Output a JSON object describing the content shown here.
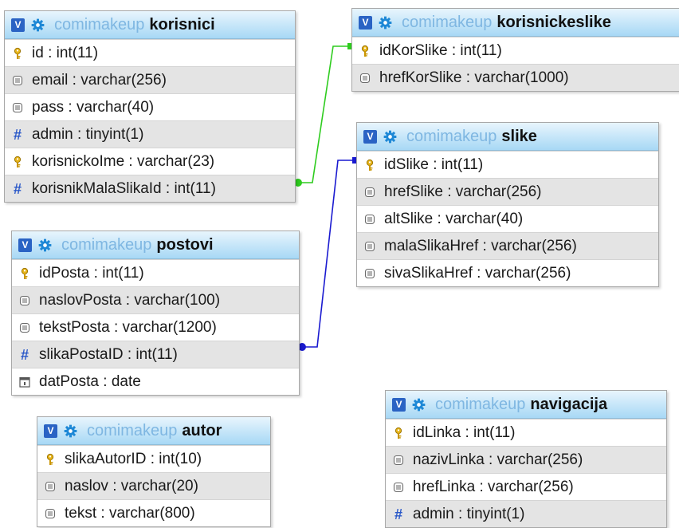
{
  "database": "comimakeup",
  "tables": {
    "korisnici": {
      "name": "korisnici",
      "columns": [
        {
          "text": "id : int(11)",
          "icon": "key-icon"
        },
        {
          "text": "email : varchar(256)",
          "icon": "text-column-icon"
        },
        {
          "text": "pass : varchar(40)",
          "icon": "text-column-icon"
        },
        {
          "text": "admin : tinyint(1)",
          "icon": "numeric-column-icon"
        },
        {
          "text": "korisnickoIme : varchar(23)",
          "icon": "key-icon"
        },
        {
          "text": "korisnikMalaSlikaId : int(11)",
          "icon": "numeric-column-icon"
        }
      ]
    },
    "korisnickeslike": {
      "name": "korisnickeslike",
      "columns": [
        {
          "text": "idKorSlike : int(11)",
          "icon": "key-icon"
        },
        {
          "text": "hrefKorSlike : varchar(1000)",
          "icon": "text-column-icon"
        }
      ]
    },
    "slike": {
      "name": "slike",
      "columns": [
        {
          "text": "idSlike : int(11)",
          "icon": "key-icon"
        },
        {
          "text": "hrefSlike : varchar(256)",
          "icon": "text-column-icon"
        },
        {
          "text": "altSlike : varchar(40)",
          "icon": "text-column-icon"
        },
        {
          "text": "malaSlikaHref : varchar(256)",
          "icon": "text-column-icon"
        },
        {
          "text": "sivaSlikaHref : varchar(256)",
          "icon": "text-column-icon"
        }
      ]
    },
    "postovi": {
      "name": "postovi",
      "columns": [
        {
          "text": "idPosta : int(11)",
          "icon": "key-icon"
        },
        {
          "text": "naslovPosta : varchar(100)",
          "icon": "text-column-icon"
        },
        {
          "text": "tekstPosta : varchar(1200)",
          "icon": "text-column-icon"
        },
        {
          "text": "slikaPostaID : int(11)",
          "icon": "numeric-column-icon"
        },
        {
          "text": "datPosta : date",
          "icon": "date-column-icon"
        }
      ]
    },
    "autor": {
      "name": "autor",
      "columns": [
        {
          "text": "slikaAutorID : int(10)",
          "icon": "key-icon"
        },
        {
          "text": "naslov : varchar(20)",
          "icon": "text-column-icon"
        },
        {
          "text": "tekst : varchar(800)",
          "icon": "text-column-icon"
        }
      ]
    },
    "navigacija": {
      "name": "navigacija",
      "columns": [
        {
          "text": "idLinka : int(11)",
          "icon": "key-icon"
        },
        {
          "text": "nazivLinka : varchar(256)",
          "icon": "text-column-icon"
        },
        {
          "text": "hrefLinka : varchar(256)",
          "icon": "text-column-icon"
        },
        {
          "text": "admin : tinyint(1)",
          "icon": "numeric-column-icon"
        }
      ]
    }
  },
  "toggle_glyph": "V",
  "colors": {
    "header_top": "#e8f5fd",
    "header_bottom": "#a7d8f5",
    "toggle": "#2a63c4",
    "gear": "#1e88d6",
    "db_text": "#7fb7e2",
    "row_alt": "#e4e4e4",
    "relation_green": "#2ecc1e",
    "relation_blue": "#1a1ad0"
  }
}
